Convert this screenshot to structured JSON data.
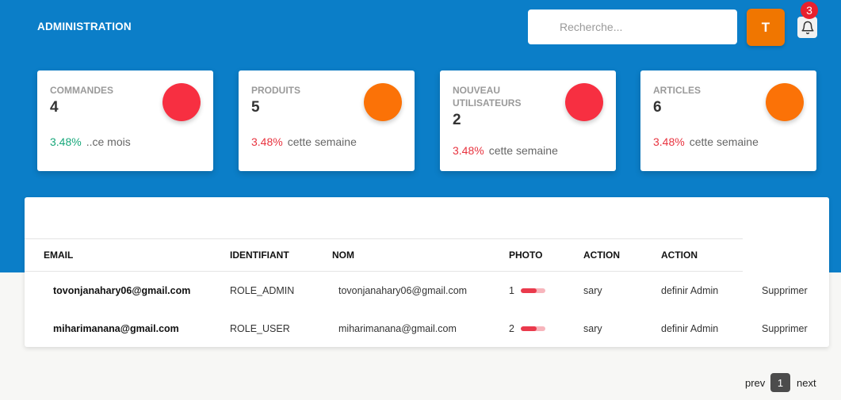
{
  "header": {
    "brand": "ADMINISTRATION",
    "search_placeholder": "Recherche...",
    "avatar_initial": "T",
    "notification_count": "3",
    "accent_color": "#0b7ec8"
  },
  "stats": [
    {
      "title": "COMMANDES",
      "value": "4",
      "percent": "3.48%",
      "note": "..ce mois",
      "trend": "up",
      "circle_color": "#f72f41"
    },
    {
      "title": "PRODUITS",
      "value": "5",
      "percent": "3.48%",
      "note": "cette semaine",
      "trend": "down",
      "circle_color": "#fb7207"
    },
    {
      "title": "NOUVEAU UTILISATEURS",
      "value": "2",
      "percent": "3.48%",
      "note": "cette semaine",
      "trend": "down",
      "circle_color": "#f72f41"
    },
    {
      "title": "ARTICLES",
      "value": "6",
      "percent": "3.48%",
      "note": "cette semaine",
      "trend": "down",
      "circle_color": "#fb7207"
    }
  ],
  "table": {
    "headers": [
      "EMAIL",
      "IDENTIFIANT",
      "NOM",
      "PHOTO",
      "ACTION",
      "ACTION"
    ],
    "rows": [
      {
        "email": "tovonjanahary06@gmail.com",
        "role": "ROLE_ADMIN",
        "nom": "tovonjanahary06@gmail.com",
        "photo_num": "1",
        "photo_level": 0.65,
        "action1": "sary",
        "action2": "definir Admin",
        "action3": "Supprimer"
      },
      {
        "email": "miharimanana@gmail.com",
        "role": "ROLE_USER",
        "nom": "miharimanana@gmail.com",
        "photo_num": "2",
        "photo_level": 0.65,
        "action1": "sary",
        "action2": "definir Admin",
        "action3": "Supprimer"
      }
    ]
  },
  "pagination": {
    "prev": "prev",
    "page": "1",
    "next": "next"
  }
}
